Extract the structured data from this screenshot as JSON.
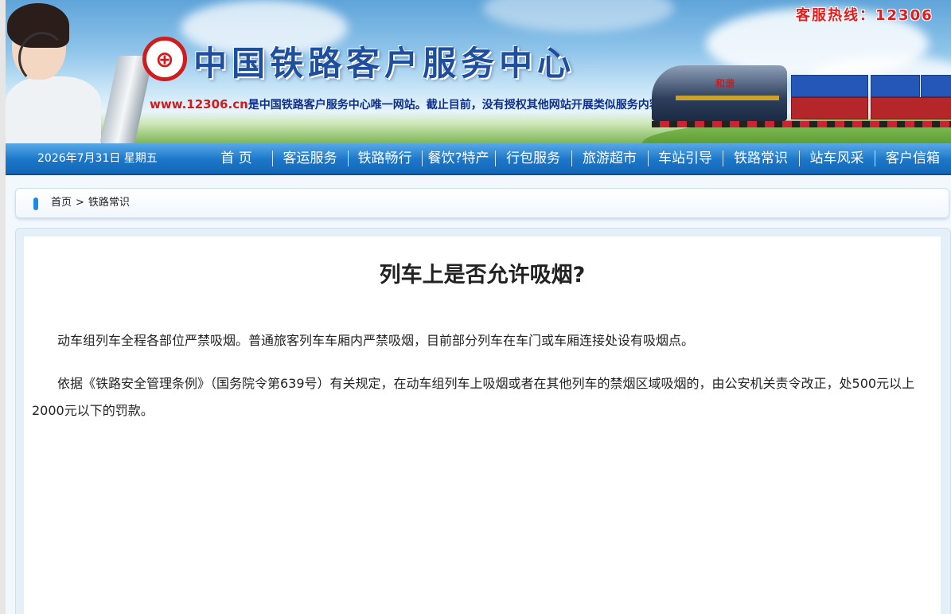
{
  "banner": {
    "hotline": "客服热线：12306",
    "logo_glyph": "⊕",
    "site_title": "中国铁路客户服务中心",
    "notice_url": "www.12306.cn",
    "notice_text": "是中国铁路客户服务中心唯一网站。截止目前，没有授权其他网站开展类似服务内容，敬请广大用户注意",
    "train_label": "和谐"
  },
  "nav": {
    "date": "2026年7月31日 星期五",
    "items": [
      "首 页",
      "客运服务",
      "铁路畅行",
      "餐饮?特产",
      "行包服务",
      "旅游超市",
      "车站引导",
      "铁路常识",
      "站车风采",
      "客户信箱"
    ]
  },
  "breadcrumb": {
    "home": "首页",
    "separator": ">",
    "current": "铁路常识"
  },
  "article": {
    "title": "列车上是否允许吸烟?",
    "paragraphs": [
      "动车组列车全程各部位严禁吸烟。普通旅客列车车厢内严禁吸烟，目前部分列车在车门或车厢连接处设有吸烟点。",
      "依据《铁路安全管理条例》（国务院令第639号）有关规定，在动车组列车上吸烟或者在其他列车的禁烟区域吸烟的，由公安机关责令改正，处500元以上2000元以下的罚款。"
    ]
  },
  "colors": {
    "nav_blue": "#1b76c9",
    "title_blue": "#1e4f9e",
    "hotline_red": "#e21b1b"
  }
}
